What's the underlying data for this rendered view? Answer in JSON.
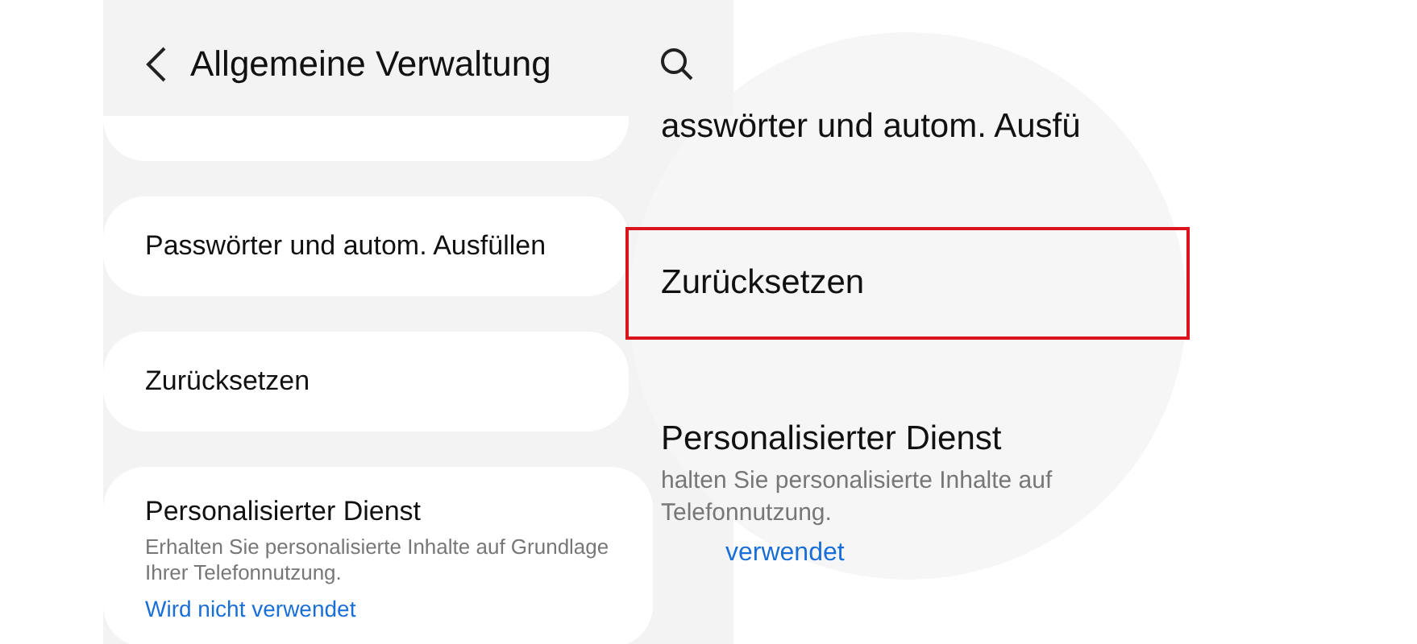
{
  "header": {
    "title": "Allgemeine Verwaltung"
  },
  "items": [
    {
      "kind": "partial"
    },
    {
      "kind": "item",
      "title": "Passwörter und autom. Ausfüllen"
    },
    {
      "kind": "item",
      "title": "Zurücksetzen"
    },
    {
      "kind": "item",
      "title": "Personalisierter Dienst",
      "description": "Erhalten Sie personalisierte Inhalte auf Grundlage Ihrer Telefonnutzung.",
      "status": "Wird nicht verwendet"
    }
  ],
  "magnifier": {
    "items": [
      {
        "title": "asswörter und autom. Ausfü",
        "highlighted": false
      },
      {
        "title": "Zurücksetzen",
        "highlighted": true
      },
      {
        "title": "Personalisierter Dienst",
        "description_lines": [
          "halten Sie personalisierte Inhalte auf",
          "Telefonnutzung."
        ],
        "status": "verwendet",
        "highlighted": false
      }
    ]
  }
}
